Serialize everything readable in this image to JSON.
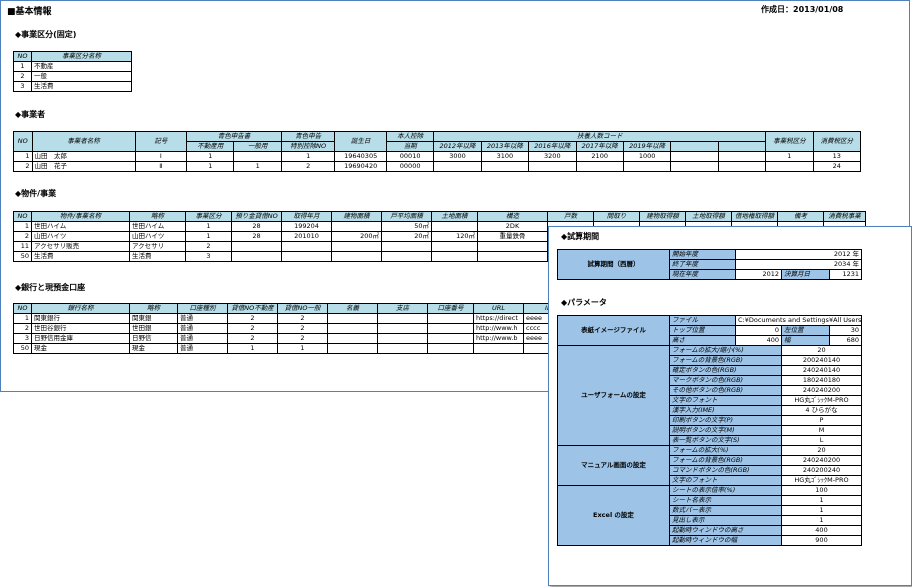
{
  "header": {
    "title": "■基本情報",
    "created": "作成日：2013/01/08"
  },
  "sec1": {
    "title": "◆事業区分(固定)",
    "cols": [
      "NO",
      "事業区分名称"
    ],
    "rows": [
      [
        "1",
        "不動産"
      ],
      [
        "2",
        "一般"
      ],
      [
        "3",
        "生活費"
      ]
    ]
  },
  "sec2": {
    "title": "◆事業者",
    "h_no": "NO",
    "h_name": "事業者名称",
    "h_sym": "記号",
    "h_blue": "青色申告書",
    "h_blue_a": "不動産用",
    "h_blue_b": "一般用",
    "h_special": "青色申告",
    "h_special2": "特別控除NO",
    "h_birth": "誕生日",
    "h_self": "本人控除",
    "h_self2": "当期",
    "h_dep": "扶養人数コード",
    "h_dep_years": [
      "2012年以降",
      "2013年以降",
      "2016年以降",
      "2017年以降",
      "2019年以降"
    ],
    "h_biztax": "事業税区分",
    "h_ctax": "消費税区分",
    "rows": [
      {
        "no": "1",
        "name": "山田　太郎",
        "sym": "Ⅰ",
        "a": "1",
        "b": "",
        "sp": "1",
        "birth": "19640305",
        "self": "00010",
        "d": [
          "3000",
          "3100",
          "3200",
          "2100",
          "1000"
        ],
        "biz": "1",
        "ct": "13"
      },
      {
        "no": "2",
        "name": "山田　花子",
        "sym": "Ⅱ",
        "a": "1",
        "b": "1",
        "sp": "2",
        "birth": "19690420",
        "self": "00000",
        "d": [
          "",
          "",
          "",
          "",
          ""
        ],
        "biz": "",
        "ct": "24"
      }
    ]
  },
  "sec3": {
    "title": "◆物件/事業",
    "cols": [
      "NO",
      "物件/事業名称",
      "略称",
      "事業区分",
      "預り金貸借NO",
      "取得年月",
      "建物面積",
      "戸平均面積",
      "土地面積",
      "構造",
      "戸数",
      "間取り",
      "建物取得額",
      "土地取得額",
      "借地権取得額",
      "備考",
      "消費税事業"
    ],
    "rows": [
      [
        "1",
        "世田ハイム",
        "世田ハイム",
        "1",
        "28",
        "199204",
        "",
        "50㎡",
        "",
        "2DK",
        "",
        "",
        "",
        "",
        "",
        "",
        ""
      ],
      [
        "2",
        "山田ハイツ",
        "山田ハイツ",
        "1",
        "28",
        "201010",
        "200㎡",
        "20㎡",
        "120㎡",
        "重量鉄骨",
        "",
        "",
        "",
        "",
        "",
        "",
        ""
      ],
      [
        "11",
        "アクセサリ販売",
        "アクセサリ",
        "2",
        "",
        "",
        "",
        "",
        "",
        "",
        "",
        "",
        "",
        "",
        "",
        "",
        ""
      ],
      [
        "50",
        "生活費",
        "生活費",
        "3",
        "",
        "",
        "",
        "",
        "",
        "",
        "",
        "",
        "",
        "",
        "",
        "",
        ""
      ]
    ]
  },
  "sec4": {
    "title": "◆銀行と現預金口座",
    "cols": [
      "NO",
      "銀行名称",
      "略称",
      "口座種別",
      "貸借NO不動産",
      "貸借NO一般",
      "名義",
      "支店",
      "口座番号",
      "URL",
      "ID"
    ],
    "rows": [
      [
        "1",
        "関東銀行",
        "関東銀",
        "普通",
        "2",
        "2",
        "",
        "",
        "",
        "https://direct",
        "eeee"
      ],
      [
        "2",
        "世田谷銀行",
        "世田銀",
        "普通",
        "2",
        "2",
        "",
        "",
        "",
        "http://www.h",
        "cccc"
      ],
      [
        "3",
        "日野信用金庫",
        "日野信",
        "普通",
        "2",
        "2",
        "",
        "",
        "",
        "http://www.b",
        "eeee"
      ],
      [
        "50",
        "現金",
        "現金",
        "普通",
        "1",
        "1",
        "",
        "",
        "",
        "",
        ""
      ]
    ]
  },
  "popup": {
    "calc_title": "◆試算期間",
    "calc_label": "試算期間（西暦）",
    "start_label": "開始年度",
    "start_val": "2012 年",
    "end_label": "終了年度",
    "end_val": "2034 年",
    "cur_label": "現在年度",
    "cur_val": "2012",
    "settle_label": "決算月日",
    "settle_val": "1231",
    "param_title": "◆パラメータ",
    "bg": {
      "cat": "表紙イメージファイル",
      "file_label": "ファイル",
      "file_val": "C:¥Documents and Settings¥All Users¥D",
      "top_label": "トップ位置",
      "top_val": "0",
      "left_label": "左位置",
      "left_val": "30",
      "h_label": "高さ",
      "h_val": "400",
      "w_label": "幅",
      "w_val": "680"
    },
    "uf": {
      "cat": "ユーザフォームの設定",
      "items": [
        [
          "フォームの拡大/縮小(%)",
          "20"
        ],
        [
          "フォームの背景色(RGB)",
          "200240140"
        ],
        [
          "確定ボタンの色(RGB)",
          "240240140"
        ],
        [
          "マークボタンの色(RGB)",
          "180240180"
        ],
        [
          "その他ボタンの色(RGB)",
          "240240200"
        ],
        [
          "文字のフォント",
          "HG丸ｺﾞｼｯｸM-PRO"
        ],
        [
          "漢字入力(IME)",
          "4 ひらがな"
        ],
        [
          "印刷ボタンの文字(P)",
          "P"
        ],
        [
          "説明ボタンの文字(M)",
          "M"
        ],
        [
          "表一覧ボタンの文字(S)",
          "L"
        ]
      ]
    },
    "mn": {
      "cat": "マニュアル画面の設定",
      "items": [
        [
          "フォームの拡大(%)",
          "20"
        ],
        [
          "フォームの背景色(RGB)",
          "240240200"
        ],
        [
          "コマンドボタンの色(RGB)",
          "240200240"
        ],
        [
          "文字のフォント",
          "HG丸ｺﾞｼｯｸM-PRO"
        ]
      ]
    },
    "ex": {
      "cat": "Excel の設定",
      "items": [
        [
          "シートの表示倍率(%)",
          "100"
        ],
        [
          "シート名表示",
          "1"
        ],
        [
          "数式バー表示",
          "1"
        ],
        [
          "見出し表示",
          "1"
        ],
        [
          "起動時ウィンドウの高さ",
          "400"
        ],
        [
          "起動時ウィンドウの幅",
          "900"
        ]
      ]
    }
  }
}
